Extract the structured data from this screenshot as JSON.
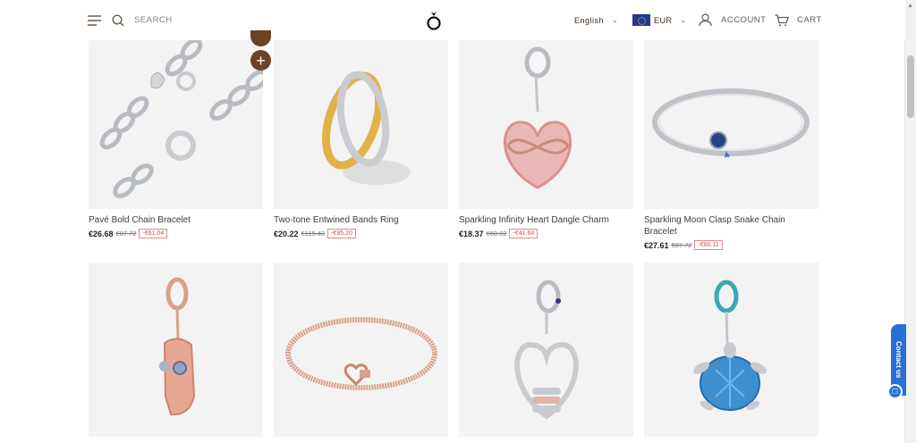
{
  "header": {
    "search_label": "SEARCH",
    "language": "English",
    "currency": "EUR",
    "account_label": "ACCOUNT",
    "cart_label": "CART"
  },
  "products": [
    {
      "name": "Pavé Bold Chain Bracelet",
      "price": "€26.68",
      "old": "€87.72",
      "discount": "-€61.04"
    },
    {
      "name": "Two-tone Entwined Bands Ring",
      "price": "€20.22",
      "old": "€115.43",
      "discount": "-€95.20"
    },
    {
      "name": "Sparkling Infinity Heart Dangle Charm",
      "price": "€18.37",
      "old": "€60.02",
      "discount": "-€41.64"
    },
    {
      "name": "Sparkling Moon Clasp Snake Chain Bracelet",
      "price": "€27.61",
      "old": "€87.72",
      "discount": "-€60.11"
    },
    {
      "name": "",
      "price": "",
      "old": "",
      "discount": ""
    },
    {
      "name": "",
      "price": "",
      "old": "",
      "discount": ""
    },
    {
      "name": "",
      "price": "",
      "old": "",
      "discount": ""
    },
    {
      "name": "",
      "price": "",
      "old": "",
      "discount": ""
    }
  ],
  "contact_label": "Contact us",
  "colors": {
    "accent": "#6b4226",
    "contact": "#2a6fd6",
    "discount": "#d94a4a"
  }
}
